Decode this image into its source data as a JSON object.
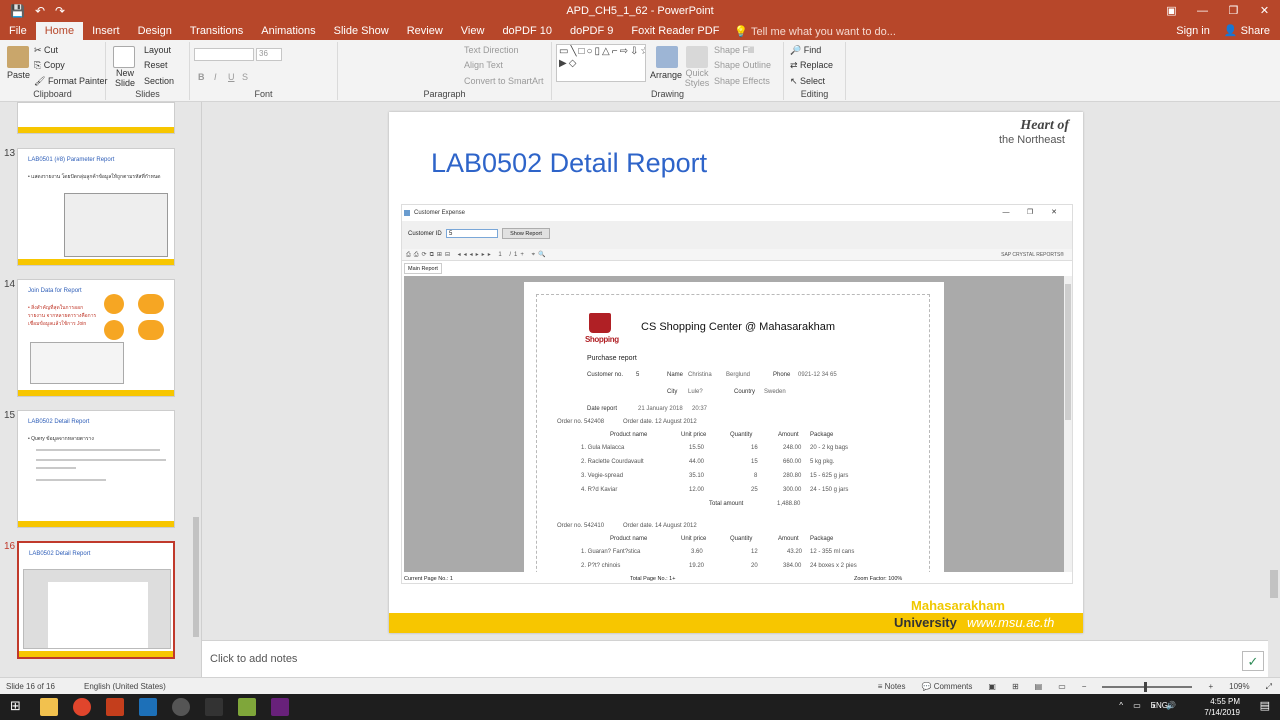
{
  "window": {
    "title": "APD_CH5_1_62 - PowerPoint",
    "controls": [
      "▣",
      "—",
      "❐",
      "✕"
    ]
  },
  "qat": {
    "save": "💾",
    "undo": "↶",
    "redo": "↷"
  },
  "ribbon_tabs": [
    "File",
    "Home",
    "Insert",
    "Design",
    "Transitions",
    "Animations",
    "Slide Show",
    "Review",
    "View",
    "doPDF 10",
    "doPDF 9",
    "Foxit Reader PDF"
  ],
  "active_tab": "Home",
  "tell_me": "Tell me what you want to do...",
  "sign_in": "Sign in",
  "share": "Share",
  "ribbon": {
    "clipboard": {
      "paste": "Paste",
      "cut": "Cut",
      "copy": "Copy",
      "format_painter": "Format Painter",
      "label": "Clipboard"
    },
    "slides": {
      "new_slide": "New Slide",
      "layout": "Layout",
      "reset": "Reset",
      "section": "Section",
      "label": "Slides"
    },
    "font": {
      "size": "36",
      "label": "Font",
      "bold": "B",
      "italic": "I",
      "underline": "U",
      "strike": "S"
    },
    "paragraph": {
      "text_direction": "Text Direction",
      "align_text": "Align Text",
      "convert": "Convert to SmartArt",
      "label": "Paragraph"
    },
    "drawing": {
      "arrange": "Arrange",
      "quick_styles": "Quick Styles",
      "shape_fill": "Shape Fill",
      "shape_outline": "Shape Outline",
      "shape_effects": "Shape Effects",
      "label": "Drawing"
    },
    "editing": {
      "find": "Find",
      "replace": "Replace",
      "select": "Select",
      "label": "Editing"
    }
  },
  "thumbnails": [
    {
      "num": "13",
      "title": "LAB0501 (#8) Parameter Report",
      "bullet": "• แสดงรายงาน โดยปัดกลุ่มลูกค้าข้อมูลให้ถูกตามรหัสที่กำหนด"
    },
    {
      "num": "14",
      "title": "Join Data for Report",
      "bullet": "• สิ่งสำคัญที่สุดในการออกรายงาน จากหลายตารางคือการเชื่อมข้อมูลแล้วใช้การ Join"
    },
    {
      "num": "15",
      "title": "LAB0502 Detail Report",
      "bullet": "• Query ข้อมูลจากหลายตาราง"
    },
    {
      "num": "16",
      "title": "LAB0502 Detail Report",
      "bullet": ""
    }
  ],
  "slide": {
    "brand_line1": "Heart of",
    "brand_line2": "the Northeast",
    "title": "LAB0502 Detail Report",
    "footer_top": "Mahasarakham",
    "footer_university": "University",
    "footer_url": "www.msu.ac.th"
  },
  "app": {
    "caption": "Customer Expense",
    "customer_id_label": "Customer ID",
    "customer_id_value": "5",
    "show_report": "Show Report",
    "page_input": "1",
    "page_of": "/1+",
    "sap_label": "SAP CRYSTAL REPORTS®",
    "main_report_tab": "Main Report",
    "status_current": "Current Page No.: 1",
    "status_total": "Total Page No.: 1+",
    "status_zoom": "Zoom Factor: 100%"
  },
  "report": {
    "logo_text": "Shopping",
    "title": "CS Shopping Center @ Mahasarakham",
    "subtitle": "Purchase report",
    "customer_no_label": "Customer no.",
    "customer_no": "5",
    "name_label": "Name",
    "first_name": "Christina",
    "last_name": "Berglund",
    "phone_label": "Phone",
    "phone": "0921-12 34 65",
    "city_label": "City",
    "city": "Lule?",
    "country_label": "Country",
    "country": "Sweden",
    "date_label": "Date report",
    "date": "21 January 2018",
    "time": "20:37",
    "headers": [
      "Product name",
      "Unit price",
      "Quantity",
      "Amount",
      "Package"
    ],
    "orders": [
      {
        "order_no": "Order no. 542408",
        "order_date": "Order date. 12 August 2012",
        "rows": [
          [
            "1. Gula Malacca",
            "15.50",
            "16",
            "248.00",
            "20 - 2 kg bags"
          ],
          [
            "2. Raclette Courdavault",
            "44.00",
            "15",
            "660.00",
            "5 kg pkg."
          ],
          [
            "3. Vegie-spread",
            "35.10",
            "8",
            "280.80",
            "15 - 625 g jars"
          ],
          [
            "4. R?d Kaviar",
            "12.00",
            "25",
            "300.00",
            "24 - 150 g jars"
          ]
        ],
        "total_label": "Total amount",
        "total": "1,488.80"
      },
      {
        "order_no": "Order no. 542410",
        "order_date": "Order date. 14 August 2012",
        "rows": [
          [
            "1. Guaran? Fant?stica",
            "3.60",
            "12",
            "43.20",
            "12 - 355 ml cans"
          ],
          [
            "2. P?t? chinois",
            "19.20",
            "20",
            "384.00",
            "24 boxes x 2 pies"
          ]
        ]
      }
    ]
  },
  "notes_placeholder": "Click to add notes",
  "status": {
    "slide": "Slide 16 of 16",
    "language": "English (United States)",
    "notes": "Notes",
    "comments": "Comments",
    "zoom": "109%"
  },
  "taskbar": {
    "lang": "ENG",
    "time": "4:55 PM",
    "date": "7/14/2019"
  }
}
